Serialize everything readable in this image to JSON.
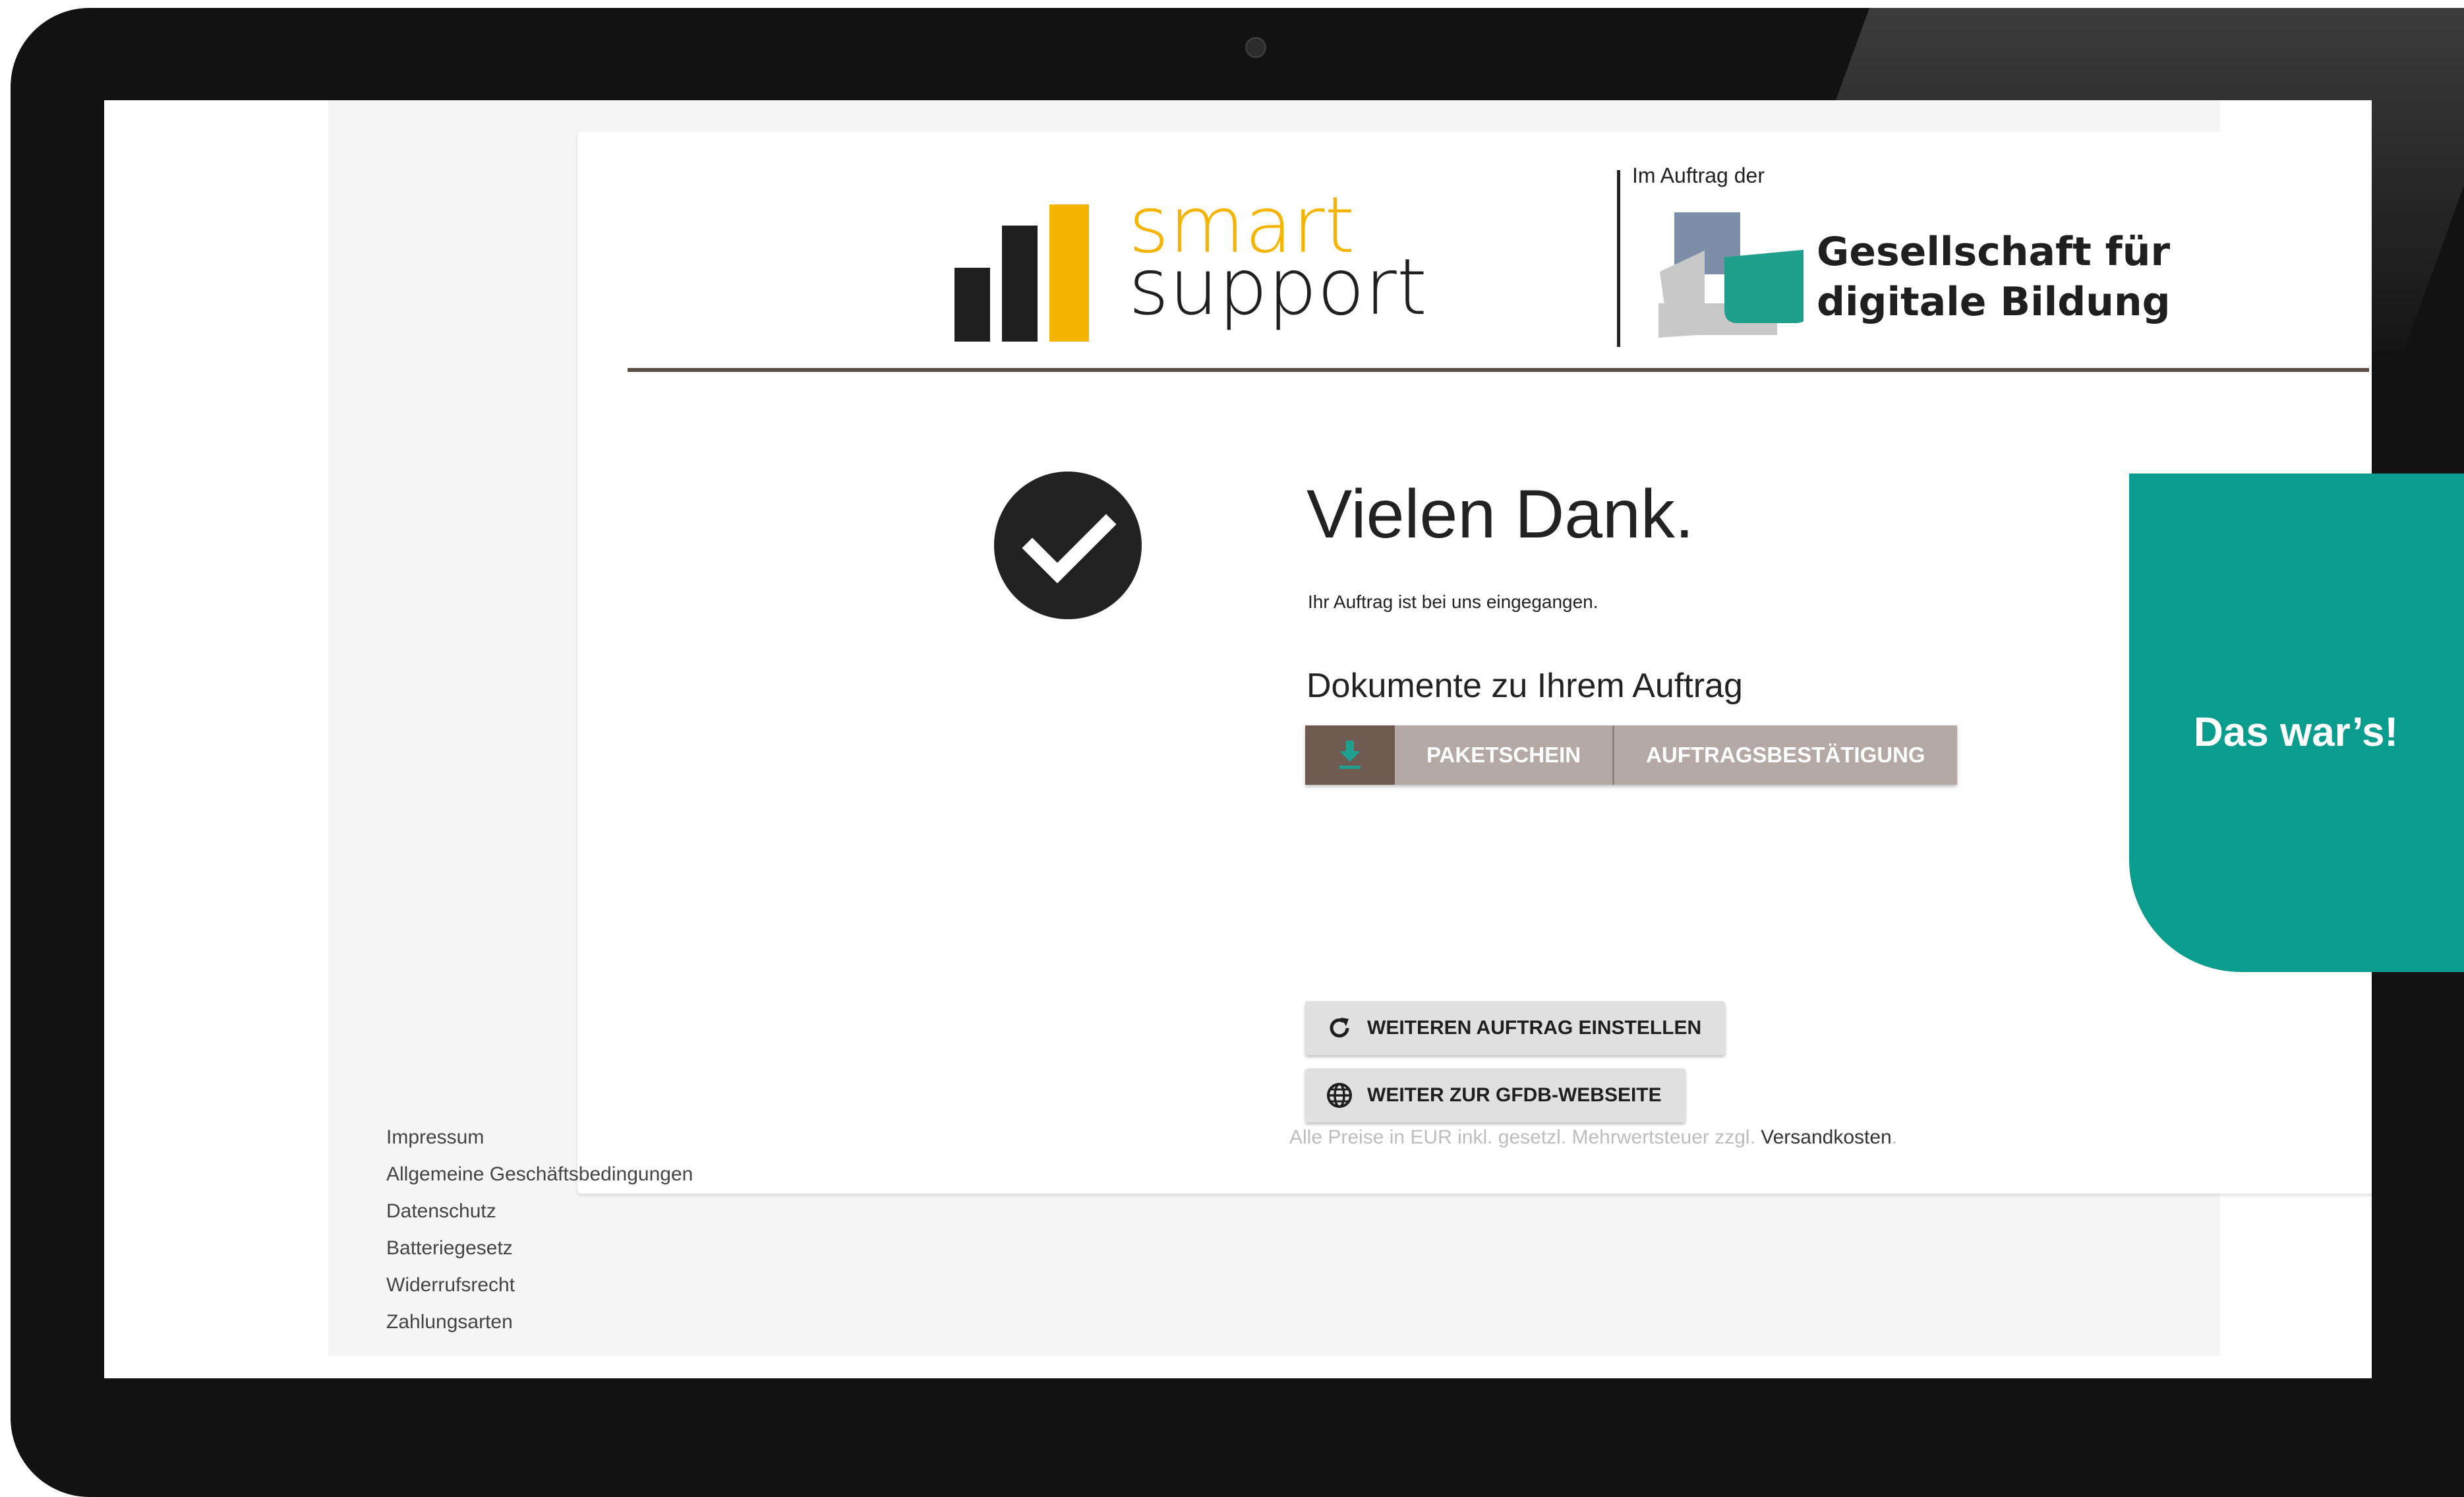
{
  "brand": {
    "smart_word": "smart",
    "support_word": "support",
    "commission_label": "Im Auftrag der",
    "partner_line1": "Gesellschaft für",
    "partner_line2": "digitale Bildung"
  },
  "confirmation": {
    "title": "Vielen Dank.",
    "subtitle": "Ihr Auftrag ist bei uns eingegangen."
  },
  "documents": {
    "heading": "Dokumente zu Ihrem Auftrag",
    "download_icon": "download-icon",
    "buttons": [
      "PAKETSCHEIN",
      "AUFTRAGSBESTÄTIGUNG"
    ]
  },
  "actions": {
    "new_order_label": "WEITEREN AUFTRAG EINSTELLEN",
    "new_order_icon": "refresh-icon",
    "website_label": "WEITER ZUR GFDB-WEBSEITE",
    "website_icon": "globe-icon"
  },
  "footer": {
    "links": [
      "Impressum",
      "Allgemeine Geschäftsbedingungen",
      "Datenschutz",
      "Batteriegesetz",
      "Widerrufsrecht",
      "Zahlungsarten"
    ],
    "price_note": "Alle Preise in EUR inkl. gesetzl. Mehrwertsteuer zzgl. ",
    "shipping_link": "Versandkosten",
    "shipping_suffix": "."
  },
  "callout": {
    "text": "Das war’s!"
  },
  "colors": {
    "brand_yellow": "#f5b400",
    "brand_dark": "#1f1f1f",
    "teal": "#0a9d8d",
    "header_rule": "#5e4e46",
    "download_button": "#6e5a50",
    "document_button": "#b4a9a5"
  }
}
